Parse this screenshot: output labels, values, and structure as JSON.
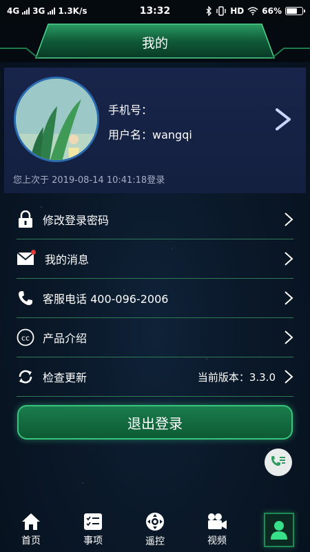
{
  "status_bar": {
    "network1": "4G",
    "network2": "3G",
    "speed": "1.3K/s",
    "time": "13:32",
    "hd": "HD",
    "battery": "66%",
    "battery_level": 0.66
  },
  "header": {
    "title": "我的"
  },
  "profile": {
    "phone_label": "手机号：",
    "username_label": "用户名：",
    "username": "wangqi",
    "last_login": "您上次于 2019-08-14 10:41:18登录"
  },
  "menu": {
    "items": [
      {
        "label": "修改登录密码",
        "icon": "lock-icon"
      },
      {
        "label": "我的消息",
        "icon": "envelope-icon"
      },
      {
        "label": "客服电话 400-096-2006",
        "icon": "phone-icon"
      },
      {
        "label": "产品介绍",
        "icon": "cc-icon"
      },
      {
        "label": "检查更新",
        "icon": "refresh-icon",
        "right": "当前版本：3.3.0"
      }
    ]
  },
  "logout_label": "退出登录",
  "tabs": [
    {
      "label": "首页",
      "icon": "home-icon"
    },
    {
      "label": "事项",
      "icon": "checklist-icon"
    },
    {
      "label": "遥控",
      "icon": "remote-icon"
    },
    {
      "label": "视频",
      "icon": "video-camera-icon"
    },
    {
      "label": "",
      "icon": "user-icon",
      "active": true
    }
  ],
  "colors": {
    "accent": "#38c57e",
    "card": "#18244a",
    "divider": "#2e7b55",
    "unread": "#e53935"
  }
}
